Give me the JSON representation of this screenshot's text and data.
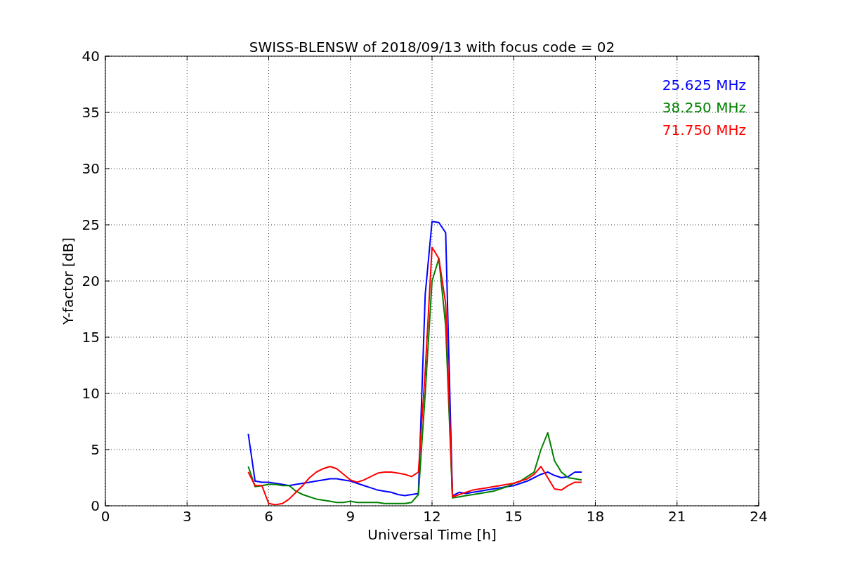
{
  "chart": {
    "chart_data": {
      "type": "line",
      "title": "SWISS-BLENSW of 2018/09/13 with focus code = 02",
      "xlabel": "Universal Time [h]",
      "ylabel": "Y-factor [dB]",
      "x": [
        5.25,
        5.5,
        5.75,
        6,
        6.25,
        6.5,
        6.75,
        7,
        7.25,
        7.5,
        7.75,
        8,
        8.25,
        8.5,
        8.75,
        9,
        9.25,
        9.5,
        9.75,
        10,
        10.25,
        10.5,
        10.75,
        11,
        11.25,
        11.5,
        11.75,
        12,
        12.25,
        12.5,
        12.75,
        13,
        13.25,
        13.5,
        13.75,
        14,
        14.25,
        14.5,
        14.75,
        15,
        15.25,
        15.5,
        15.75,
        16,
        16.25,
        16.5,
        16.75,
        17,
        17.25,
        17.5
      ],
      "series": [
        {
          "name": "25.625 MHz",
          "color": "#0000ff",
          "values": [
            6.4,
            2.2,
            2.1,
            2.1,
            2.0,
            1.9,
            1.8,
            1.9,
            2.0,
            2.1,
            2.2,
            2.3,
            2.4,
            2.4,
            2.3,
            2.2,
            2.0,
            1.8,
            1.6,
            1.4,
            1.3,
            1.2,
            1.0,
            0.9,
            1.0,
            1.1,
            18.8,
            25.3,
            25.2,
            24.3,
            0.9,
            1.2,
            1.1,
            1.2,
            1.3,
            1.4,
            1.5,
            1.6,
            1.7,
            1.8,
            2.0,
            2.2,
            2.5,
            2.8,
            3.0,
            2.7,
            2.5,
            2.6,
            3.0,
            3.0
          ]
        },
        {
          "name": "38.250 MHz",
          "color": "#008000",
          "values": [
            3.5,
            1.7,
            1.8,
            1.9,
            1.9,
            1.8,
            1.8,
            1.3,
            1.0,
            0.8,
            0.6,
            0.5,
            0.4,
            0.3,
            0.3,
            0.4,
            0.3,
            0.3,
            0.3,
            0.3,
            0.2,
            0.2,
            0.2,
            0.2,
            0.3,
            1.0,
            10.0,
            20.0,
            22.0,
            16.0,
            0.7,
            0.8,
            0.9,
            1.0,
            1.1,
            1.2,
            1.3,
            1.5,
            1.7,
            2.0,
            2.2,
            2.6,
            3.0,
            5.0,
            6.5,
            4.0,
            3.0,
            2.5,
            2.4,
            2.3
          ]
        },
        {
          "name": "71.750 MHz",
          "color": "#ff0000",
          "values": [
            3.0,
            1.8,
            1.8,
            0.2,
            0.1,
            0.2,
            0.6,
            1.2,
            1.8,
            2.5,
            3.0,
            3.3,
            3.5,
            3.3,
            2.8,
            2.3,
            2.1,
            2.3,
            2.6,
            2.9,
            3.0,
            3.0,
            2.9,
            2.8,
            2.6,
            3.0,
            12.0,
            23.0,
            22.0,
            18.0,
            0.8,
            1.0,
            1.2,
            1.4,
            1.5,
            1.6,
            1.7,
            1.8,
            1.9,
            2.0,
            2.2,
            2.4,
            2.8,
            3.5,
            2.5,
            1.5,
            1.4,
            1.8,
            2.1,
            2.1
          ]
        }
      ],
      "xlim": [
        0,
        24
      ],
      "ylim": [
        0,
        40
      ],
      "xticks": [
        0,
        3,
        6,
        9,
        12,
        15,
        18,
        21,
        24
      ],
      "yticks": [
        0,
        5,
        10,
        15,
        20,
        25,
        30,
        35,
        40
      ],
      "grid": true
    }
  }
}
